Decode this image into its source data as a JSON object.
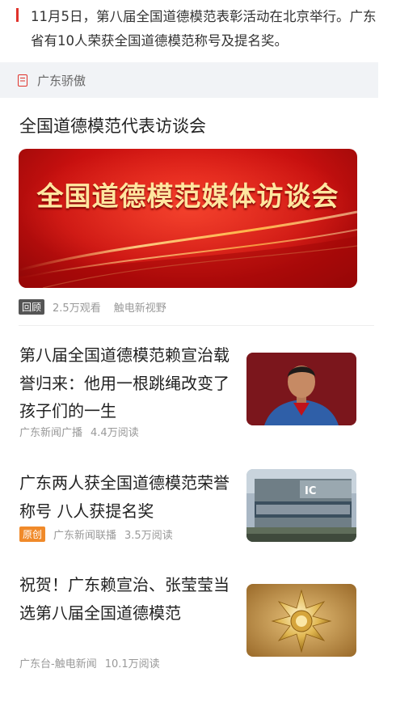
{
  "intro": {
    "text": "11月5日，第八届全国道德模范表彰活动在北京举行。广东省有10人荣获全国道德模范称号及提名奖。"
  },
  "section": {
    "label": "广东骄傲",
    "icon": "document-icon"
  },
  "video": {
    "title": "全国道德模范代表访谈会",
    "banner_text": "全国道德模范媒体访谈会",
    "tag": "回顾",
    "views": "2.5万观看",
    "source": "触电新视野"
  },
  "articles": [
    {
      "title": "第八届全国道德模范赖宣治载誉归来：他用一根跳绳改变了孩子们的一生",
      "badge": "",
      "source": "广东新闻广播",
      "reads": "4.4万阅读",
      "thumb": "portrait"
    },
    {
      "title": "广东两人获全国道德模范荣誉称号 八人获提名奖",
      "badge": "原创",
      "source": "广东新闻联播",
      "reads": "3.5万阅读",
      "thumb": "building"
    },
    {
      "title": "祝贺！广东赖宣治、张莹莹当选第八届全国道德模范",
      "badge": "",
      "source": "广东台-触电新闻",
      "reads": "10.1万阅读",
      "thumb": "medal"
    }
  ],
  "colors": {
    "accent": "#e0322b",
    "badge_orange": "#f08a2a",
    "header_bg": "#f1f3f6"
  }
}
